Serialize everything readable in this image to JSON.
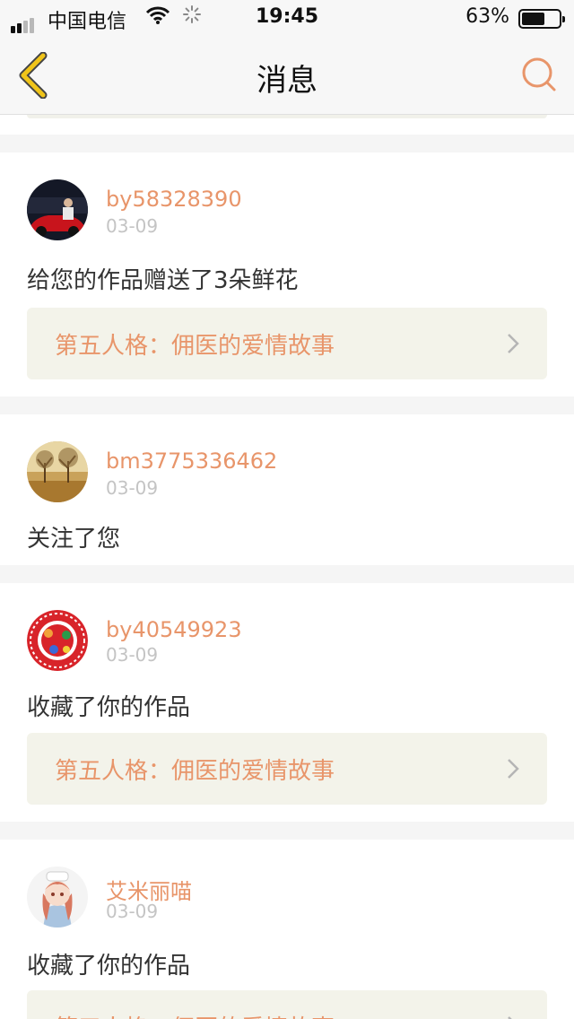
{
  "status_bar": {
    "carrier": "中国电信",
    "time": "19:45",
    "battery_percent": "63%",
    "battery_level": 0.63,
    "icons": [
      "signal-icon",
      "wifi-icon",
      "loading-icon",
      "battery-icon"
    ]
  },
  "nav": {
    "title": "消息",
    "back_icon": "chevron-left-icon",
    "search_icon": "search-icon"
  },
  "colors": {
    "accent": "#e8956a",
    "back_icon": "#f0c419",
    "card_link_bg": "#f3f3ea",
    "date": "#c4c4c4",
    "background": "#f5f5f5"
  },
  "messages": [
    {
      "username": "by58328390",
      "date": "03-09",
      "action": "给您的作品赠送了3朵鲜花",
      "work_title": "第五人格：佣医的爱情故事"
    },
    {
      "username": "bm3775336462",
      "date": "03-09",
      "action": "关注了您"
    },
    {
      "username": "by40549923",
      "date": "03-09",
      "action": "收藏了你的作品",
      "work_title": "第五人格：佣医的爱情故事"
    },
    {
      "username": "艾米丽喵",
      "date": "03-09",
      "action": "收藏了你的作品",
      "work_title": "第五人格：佣医的爱情故事"
    }
  ]
}
